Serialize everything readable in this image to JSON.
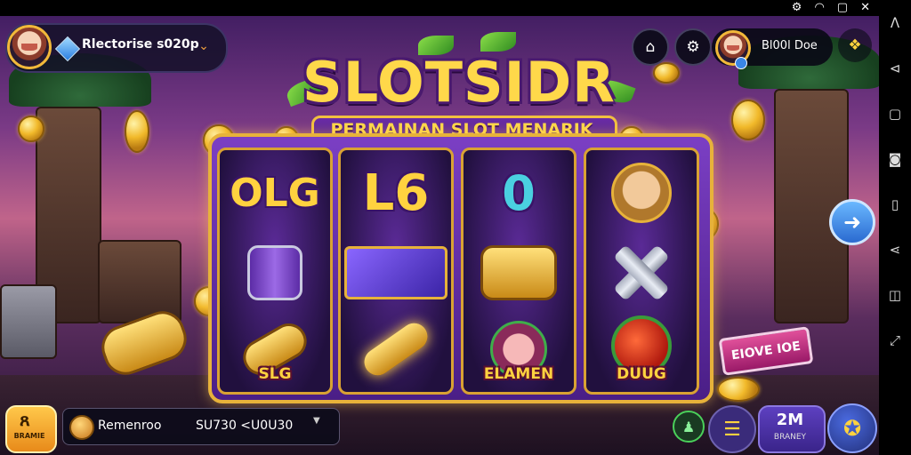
{
  "statusbar": {
    "icons": [
      "settings-icon",
      "wifi-icon",
      "window-icon",
      "close-icon"
    ]
  },
  "navbar": {
    "icons": [
      "grid-icon",
      "arrow-left-icon",
      "square-icon",
      "record-icon",
      "square-outline-icon",
      "share-icon",
      "screenshot-icon",
      "fullscreen-icon"
    ]
  },
  "profile": {
    "name": "Rlectorise s020p",
    "dropdown": "⌄"
  },
  "header_buttons": {
    "home": "⌂",
    "settings": "⚙"
  },
  "user": {
    "name": "Bl00l Doe"
  },
  "top_right": {
    "menu": "❖"
  },
  "logo": {
    "title": "SLOTSIDR",
    "subtitle": "PERMAINAN SLOT MENARIK"
  },
  "reels": [
    {
      "top": "OLG",
      "bottom_label": "SLG"
    },
    {
      "top": "L6"
    },
    {
      "top": "0"
    },
    {
      "mid_label": "ELAMEN",
      "bottom_label": "DUUG"
    }
  ],
  "side": {
    "next": "➜",
    "sign": "EIOVE IOE"
  },
  "bottom": {
    "left_button": {
      "icon": "ጸ",
      "label": "BRAMIE"
    },
    "referral": {
      "label": "Remenroo",
      "value": "SU730 <U0U30"
    },
    "small_btn": "♟",
    "menu_btn": "☰",
    "bet": {
      "value": "2M",
      "label": "BRANEY"
    },
    "spin": "✪"
  },
  "colors": {
    "accent": "#e7b23a",
    "machine": "#5a28a0",
    "background_sky": "#c0648a"
  }
}
